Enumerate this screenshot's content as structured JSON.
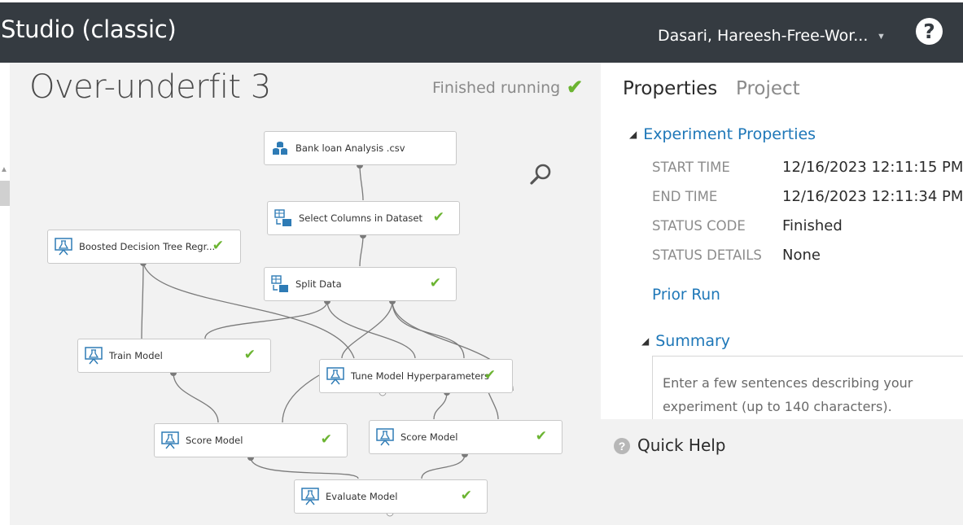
{
  "app": {
    "title": "Studio (classic)",
    "workspace": "Dasari, Hareesh-Free-Wor...",
    "help_symbol": "?"
  },
  "experiment": {
    "title": "Over-underfit 3",
    "status": "Finished running"
  },
  "colors": {
    "topbar": "#353b41",
    "accent": "#1e77b8",
    "success": "#6bb431"
  },
  "modules": [
    {
      "id": "bank",
      "label": "Bank loan Analysis .csv",
      "icon": "dataset-icon",
      "checked": false
    },
    {
      "id": "select",
      "label": "Select Columns in Dataset",
      "icon": "data-transform-icon",
      "checked": true
    },
    {
      "id": "boosted",
      "label": "Boosted Decision Tree Regr...",
      "icon": "flask-icon",
      "checked": true
    },
    {
      "id": "split",
      "label": "Split Data",
      "icon": "data-transform-icon",
      "checked": true
    },
    {
      "id": "train",
      "label": "Train Model",
      "icon": "flask-icon",
      "checked": true
    },
    {
      "id": "tune",
      "label": "Tune Model Hyperparameters",
      "icon": "flask-icon",
      "checked": true
    },
    {
      "id": "score1",
      "label": "Score Model",
      "icon": "flask-icon",
      "checked": true
    },
    {
      "id": "score2",
      "label": "Score Model",
      "icon": "flask-icon",
      "checked": true
    },
    {
      "id": "evaluate",
      "label": "Evaluate Model",
      "icon": "flask-icon",
      "checked": true
    }
  ],
  "properties": {
    "tabs": [
      "Properties",
      "Project"
    ],
    "section_title": "Experiment Properties",
    "rows": [
      {
        "key": "START TIME",
        "value": "12/16/2023 12:11:15 PM"
      },
      {
        "key": "END TIME",
        "value": "12/16/2023 12:11:34 PM"
      },
      {
        "key": "STATUS CODE",
        "value": "Finished"
      },
      {
        "key": "STATUS DETAILS",
        "value": "None"
      }
    ],
    "prior_run": "Prior Run",
    "summary_title": "Summary",
    "summary_placeholder": "Enter a few sentences describing your experiment (up to 140 characters)."
  },
  "quick_help": {
    "label": "Quick Help"
  }
}
